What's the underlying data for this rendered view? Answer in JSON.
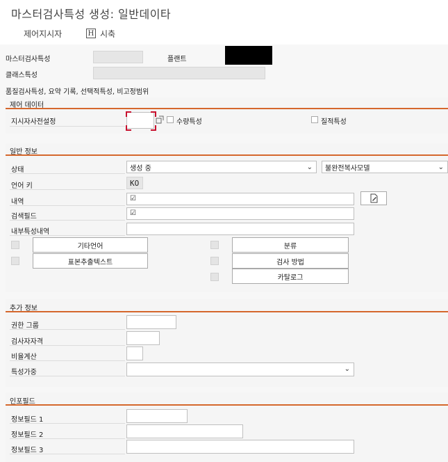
{
  "window": {
    "title": "마스터검사특성 생성: 일반데이타"
  },
  "toolbar": {
    "control_label": "제어지시자",
    "start_label": "시축",
    "start_icon": "H"
  },
  "header": {
    "master_char_label": "마스터검사특성",
    "master_char_value": "",
    "plant_label": "플랜트",
    "class_char_label": "클래스특성",
    "class_char_value": "",
    "summary_text": "품질검사특성, 요약 기록, 선택적특성, 비고정범위"
  },
  "control": {
    "title": "제어 데이터",
    "preset_label": "지시자사전설정",
    "preset_value": "",
    "quantitative_label": "수량특성",
    "qualitative_label": "질적특성"
  },
  "general": {
    "title": "일반 정보",
    "status_label": "상태",
    "status_value": "생성 중",
    "copy_model_value": "불완전복사모델",
    "lang_key_label": "언어 키",
    "lang_key_value": "KO",
    "description_label": "내역",
    "search_field_label": "검색필드",
    "internal_desc_label": "내부특성내역",
    "other_lang_button": "기타언어",
    "sample_text_button": "표본추출텍스트",
    "class_button": "분류",
    "inspection_method_button": "검사 방법",
    "catalog_button": "카탈로그"
  },
  "additional": {
    "title": "추가 정보",
    "auth_group_label": "권한 그룹",
    "inspector_qual_label": "검사자자격",
    "ratio_calc_label": "비율계산",
    "char_weight_label": "특성가중"
  },
  "info": {
    "title": "인포필드",
    "field1_label": "정보필드 1",
    "field2_label": "정보필드 2",
    "field3_label": "정보필드 3"
  },
  "colors": {
    "accent": "#d5672c",
    "focus": "#c8102e"
  }
}
